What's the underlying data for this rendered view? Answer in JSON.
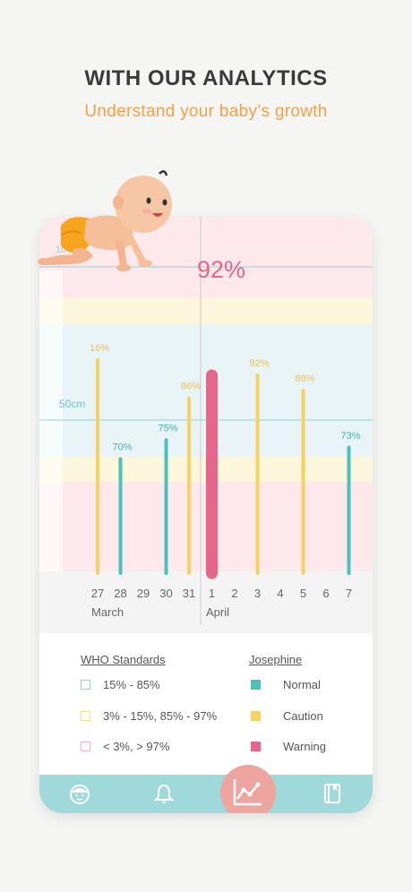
{
  "header": {
    "title": "WITH OUR ANALYTICS",
    "subtitle": "Understand your baby’s growth"
  },
  "chart": {
    "highlight_value": "92%",
    "partial_top_label": "10",
    "height_marker": "50cm",
    "month_labels": [
      "March",
      "April"
    ],
    "days": [
      "27",
      "28",
      "29",
      "30",
      "31",
      "1",
      "2",
      "3",
      "4",
      "5",
      "6",
      "7"
    ]
  },
  "chart_data": {
    "type": "bar",
    "categories": [
      "27",
      "28",
      "29",
      "30",
      "31",
      "1",
      "2",
      "3",
      "4",
      "5",
      "6",
      "7"
    ],
    "values": [
      96,
      70,
      null,
      75,
      86,
      92,
      null,
      92,
      null,
      88,
      null,
      73
    ],
    "labels": [
      "16%",
      "70%",
      "",
      "75%",
      "86%",
      "92%",
      "",
      "92%",
      "",
      "88%",
      "",
      "73%"
    ],
    "status": [
      "caution",
      "normal",
      null,
      "normal",
      "caution",
      "warning",
      null,
      "caution",
      null,
      "caution",
      null,
      "normal"
    ],
    "colors": {
      "normal": "#4cc0bc",
      "caution": "#f6d164",
      "warning": "#e4668a"
    }
  },
  "legend": {
    "who_title": "WHO Standards",
    "who_items": [
      {
        "label": "15% - 85%",
        "color": "#8fd4d4"
      },
      {
        "label": "3% - 15%, 85% - 97%",
        "color": "#f6e08a"
      },
      {
        "label": "< 3%, > 97%",
        "color": "#f3b3c3"
      }
    ],
    "baby_title": "Josephine",
    "baby_items": [
      {
        "label": "Normal",
        "color": "#4cc0bc"
      },
      {
        "label": "Caution",
        "color": "#f6d164"
      },
      {
        "label": "Warning",
        "color": "#e4668a"
      }
    ]
  },
  "nav": {
    "items": [
      "baby-profile-icon",
      "bell-icon",
      "chart-icon",
      "book-icon"
    ]
  }
}
